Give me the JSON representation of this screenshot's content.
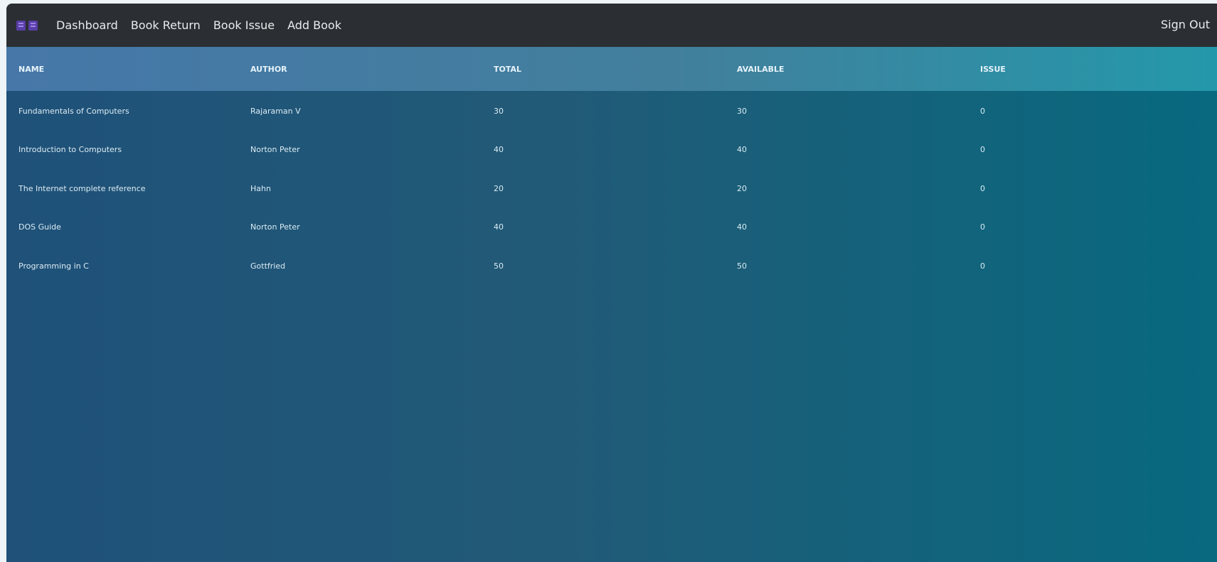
{
  "navbar": {
    "logo_icon": "book-logo-icon",
    "links": [
      "Dashboard",
      "Book Return",
      "Book Issue",
      "Add Book"
    ],
    "signout_label": "Sign Out"
  },
  "table": {
    "headers": [
      "NAME",
      "AUTHOR",
      "TOTAL",
      "AVAILABLE",
      "ISSUE"
    ],
    "rows": [
      [
        "Fundamentals of Computers",
        "Rajaraman V",
        "30",
        "30",
        "0"
      ],
      [
        "Introduction to Computers",
        "Norton Peter",
        "40",
        "40",
        "0"
      ],
      [
        "The Internet complete reference",
        "Hahn",
        "20",
        "20",
        "0"
      ],
      [
        "DOS Guide",
        "Norton Peter",
        "40",
        "40",
        "0"
      ],
      [
        "Programming in C",
        "Gottfried",
        "50",
        "50",
        "0"
      ]
    ]
  },
  "colors": {
    "navbar_bg": "#2b2f33",
    "accent": "#5a3ea8",
    "body_gradient_start": "#1f5179",
    "body_gradient_end": "#08697f"
  }
}
